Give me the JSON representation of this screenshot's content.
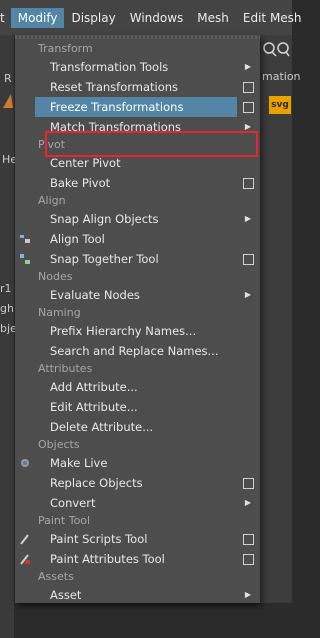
{
  "menubar": {
    "items": [
      "t",
      "Modify",
      "Display",
      "Windows",
      "Mesh",
      "Edit Mesh"
    ]
  },
  "background": {
    "left_chars": [
      "R",
      "He",
      "r1",
      "gh",
      "bje"
    ],
    "right_text": "mation",
    "right_button": "svg"
  },
  "menu": {
    "sections": {
      "transform": "Transform",
      "pivot": "Pivot",
      "align": "Align",
      "nodes": "Nodes",
      "naming": "Naming",
      "attributes": "Attributes",
      "objects": "Objects",
      "paint_tool": "Paint Tool",
      "assets": "Assets"
    },
    "items": {
      "transformation_tools": "Transformation Tools",
      "reset_transformations": "Reset Transformations",
      "freeze_transformations": "Freeze Transformations",
      "match_transformations": "Match Transformations",
      "center_pivot": "Center Pivot",
      "bake_pivot": "Bake Pivot",
      "snap_align_objects": "Snap Align Objects",
      "align_tool": "Align Tool",
      "snap_together_tool": "Snap Together Tool",
      "evaluate_nodes": "Evaluate Nodes",
      "prefix_hierarchy_names": "Prefix Hierarchy Names...",
      "search_replace_names": "Search and Replace Names...",
      "add_attribute": "Add Attribute...",
      "edit_attribute": "Edit Attribute...",
      "delete_attribute": "Delete Attribute...",
      "make_live": "Make Live",
      "replace_objects": "Replace Objects",
      "convert": "Convert",
      "paint_scripts_tool": "Paint Scripts Tool",
      "paint_attributes_tool": "Paint Attributes Tool",
      "asset": "Asset"
    }
  },
  "colors": {
    "highlight": "#5285a6",
    "annotation_frame": "#e8262b",
    "menu_bg": "#4d4d4d"
  }
}
